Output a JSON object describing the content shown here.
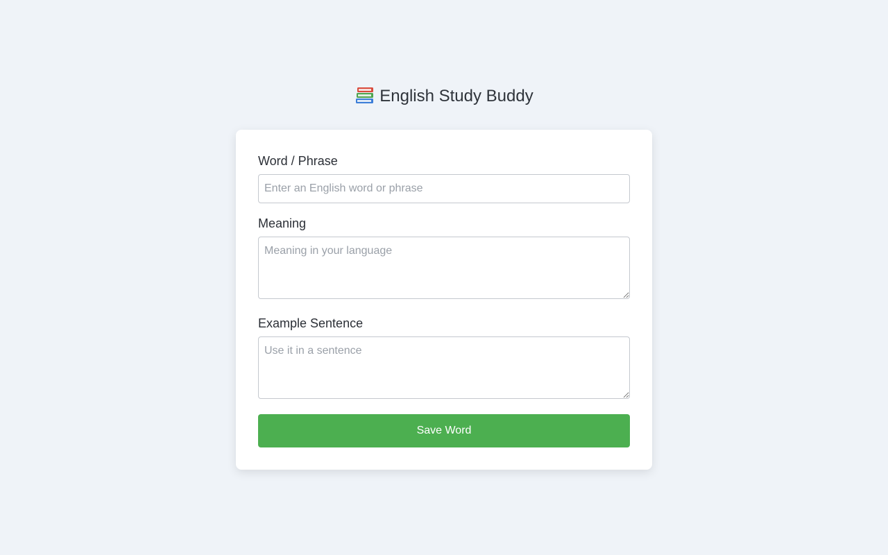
{
  "header": {
    "title": "English Study Buddy",
    "icon": "books-icon"
  },
  "form": {
    "word": {
      "label": "Word / Phrase",
      "value": "",
      "placeholder": "Enter an English word or phrase"
    },
    "meaning": {
      "label": "Meaning",
      "value": "",
      "placeholder": "Meaning in your language"
    },
    "example": {
      "label": "Example Sentence",
      "value": "",
      "placeholder": "Use it in a sentence"
    },
    "save_label": "Save Word"
  },
  "colors": {
    "background": "#eff3f8",
    "card": "#ffffff",
    "primary_button": "#4caf50",
    "text": "#2b2f36",
    "placeholder": "#9aa0a8"
  }
}
